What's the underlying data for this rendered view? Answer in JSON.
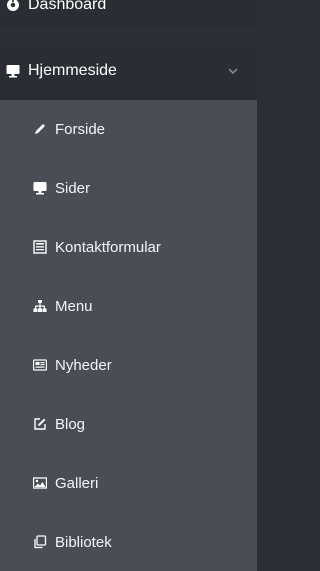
{
  "sidebar": {
    "dashboard_label": "Dashboard",
    "section_label": "Hjemmeside",
    "items": [
      {
        "label": "Forside",
        "icon": "pencil-icon"
      },
      {
        "label": "Sider",
        "icon": "monitor-icon"
      },
      {
        "label": "Kontaktformular",
        "icon": "list-box-icon"
      },
      {
        "label": "Menu",
        "icon": "sitemap-icon"
      },
      {
        "label": "Nyheder",
        "icon": "newspaper-icon"
      },
      {
        "label": "Blog",
        "icon": "edit-icon"
      },
      {
        "label": "Galleri",
        "icon": "image-icon"
      },
      {
        "label": "Bibliotek",
        "icon": "copy-icon"
      }
    ]
  },
  "colors": {
    "top_bg": "#2a2d33",
    "section_bg": "#262a2f",
    "submenu_bg": "#484d56",
    "text": "#ffffff"
  }
}
